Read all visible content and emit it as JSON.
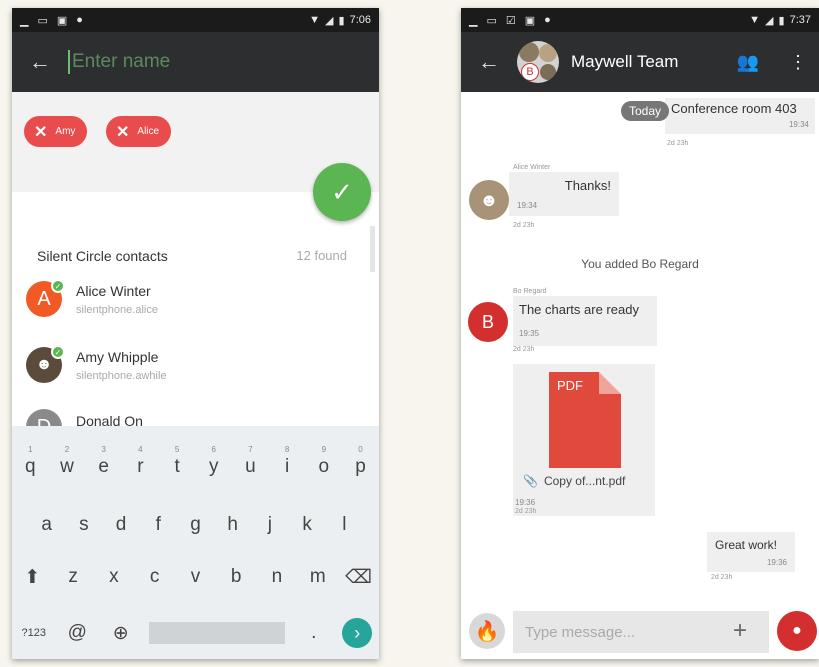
{
  "left_screen": {
    "status": {
      "time": "7:06"
    },
    "name_placeholder": "Enter name",
    "chips": [
      {
        "label": "Amy",
        "color": "#e84c4c"
      },
      {
        "label": "Alice",
        "color": "#e84c4c"
      }
    ],
    "confirm_icon": "checkmark-icon",
    "contacts_header": "Silent Circle contacts",
    "found_count": "12 found",
    "contacts": [
      {
        "name": "Alice Winter",
        "handle": "silentphone.alice",
        "initial": "A",
        "color": "#f15a24"
      },
      {
        "name": "Amy Whipple",
        "handle": "silentphone.awhile",
        "initial": "",
        "color": "#5a4b3a"
      },
      {
        "name": "Donald On",
        "handle": "",
        "initial": "D",
        "color": "#8a8a8a"
      }
    ],
    "keyboard": {
      "row1": [
        "q",
        "w",
        "e",
        "r",
        "t",
        "y",
        "u",
        "i",
        "o",
        "p"
      ],
      "row1_nums": [
        "1",
        "2",
        "3",
        "4",
        "5",
        "6",
        "7",
        "8",
        "9",
        "0"
      ],
      "row2": [
        "a",
        "s",
        "d",
        "f",
        "g",
        "h",
        "j",
        "k",
        "l"
      ],
      "row3": [
        "z",
        "x",
        "c",
        "v",
        "b",
        "n",
        "m"
      ],
      "sym": "?123",
      "at": "@",
      "period": "."
    }
  },
  "right_screen": {
    "status": {
      "time": "7:37"
    },
    "title": "Maywell Team",
    "today": "Today",
    "messages": {
      "m1": {
        "text": "Conference room 403",
        "time": "19:34",
        "meta": "2d 23h"
      },
      "m2": {
        "sender": "Alice Winter",
        "text": "Thanks!",
        "time": "19:34",
        "meta": "2d 23h"
      },
      "system": "You added Bo Regard",
      "m3": {
        "sender": "Bo Regard",
        "text": "The charts are ready",
        "time": "19:35",
        "meta": "2d 23h",
        "avatar_initial": "B"
      },
      "m4": {
        "pdf_label": "PDF",
        "file": "Copy of...nt.pdf",
        "time": "19:36",
        "meta": "2d 23h"
      },
      "m5": {
        "text": "Great work!",
        "time": "19:36",
        "meta": "2d 23h"
      }
    },
    "input_placeholder": "Type message...",
    "accent": "#d32f2f"
  }
}
